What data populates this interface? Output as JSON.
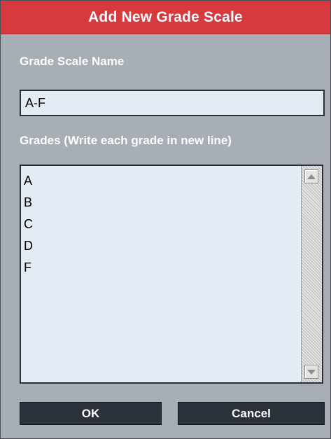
{
  "dialog": {
    "title": "Add New Grade Scale"
  },
  "name_field": {
    "label": "Grade Scale Name",
    "value": "A-F"
  },
  "grades_field": {
    "label": "Grades (Write each grade in new line)",
    "value": "A\nB\nC\nD\nF"
  },
  "buttons": {
    "ok": "OK",
    "cancel": "Cancel"
  },
  "colors": {
    "title_bar": "#d63a3f",
    "background": "#a7aeb5",
    "field_background": "#e3ebf4",
    "button": "#2b323b"
  },
  "icons": {
    "scroll_up": "triangle-up-icon",
    "scroll_down": "triangle-down-icon"
  }
}
